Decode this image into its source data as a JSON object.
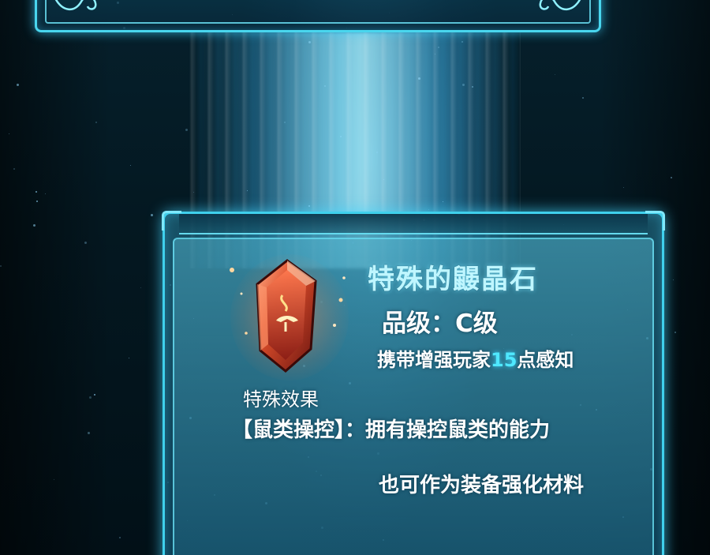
{
  "item": {
    "name": "特殊的鼹晶石",
    "grade": "品级：C级",
    "stat_prefix": "携带增强玩家",
    "stat_value": "15",
    "stat_suffix": "点感知",
    "effect_heading": "特殊效果",
    "effect_line": "【鼠类操控】：拥有操控鼠类的能力",
    "extra_line": "也可作为装备强化材料",
    "icon": "red-crystal-gem-icon"
  },
  "colors": {
    "frame": "#3fd0ec",
    "title": "#bff6ff",
    "stat_highlight": "#4fe8ff",
    "gem": "#d8442a"
  }
}
